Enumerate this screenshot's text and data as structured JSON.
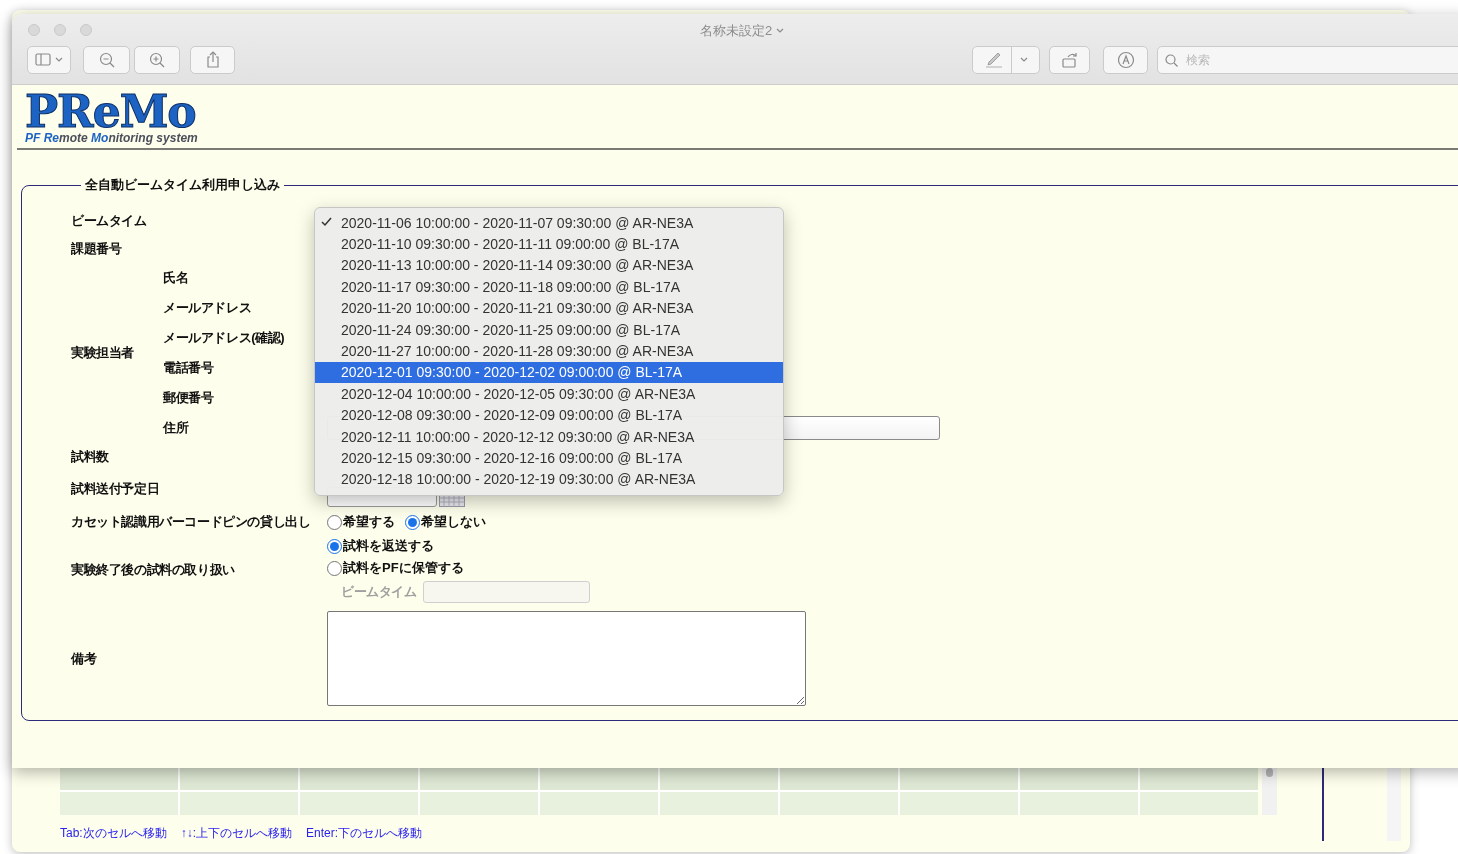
{
  "window": {
    "title": "名称未設定2",
    "search": {
      "placeholder": "検索"
    }
  },
  "logo": {
    "name": "PReMo",
    "tagline": "**PF** **Re**mote **Mo**nitoring system"
  },
  "form": {
    "legend": "全自動ビームタイム利用申し込み",
    "fields": [
      {
        "kind": "label",
        "label": "ビームタイム"
      },
      {
        "kind": "label",
        "label": "課題番号"
      },
      {
        "kind": "group",
        "label": "実験担当者",
        "children": [
          {
            "kind": "label",
            "label": "氏名"
          },
          {
            "kind": "label",
            "label": "メールアドレス"
          },
          {
            "kind": "label",
            "label": "メールアドレス(確認)"
          },
          {
            "kind": "label",
            "label": "電話番号"
          },
          {
            "kind": "label",
            "label": "郵便番号"
          },
          {
            "kind": "text",
            "label": "住所"
          }
        ]
      },
      {
        "kind": "label",
        "label": "試料数"
      },
      {
        "kind": "date",
        "label": "試料送付予定日"
      },
      {
        "kind": "radio",
        "label": "カセット認識用バーコードピンの貸し出し",
        "options": [
          {
            "label": "希望する",
            "selected": false
          },
          {
            "label": "希望しない",
            "selected": true
          }
        ]
      },
      {
        "kind": "radio-stack",
        "label": "実験終了後の試料の取り扱い",
        "options": [
          {
            "label": "試料を返送する",
            "selected": true
          },
          {
            "label": "試料をPFに保管する",
            "selected": false
          }
        ],
        "sub_field": {
          "label": "ビームタイム",
          "disabled": true
        }
      },
      {
        "kind": "textarea",
        "label": "備考"
      }
    ]
  },
  "popup": {
    "options": [
      {
        "text": "2020-11-06 10:00:00 - 2020-11-07 09:30:00 @ AR-NE3A",
        "checked": true,
        "selected": false
      },
      {
        "text": "2020-11-10 09:30:00 - 2020-11-11 09:00:00 @ BL-17A",
        "checked": false,
        "selected": false
      },
      {
        "text": "2020-11-13 10:00:00 - 2020-11-14 09:30:00 @ AR-NE3A",
        "checked": false,
        "selected": false
      },
      {
        "text": "2020-11-17 09:30:00 - 2020-11-18 09:00:00 @ BL-17A",
        "checked": false,
        "selected": false
      },
      {
        "text": "2020-11-20 10:00:00 - 2020-11-21 09:30:00 @ AR-NE3A",
        "checked": false,
        "selected": false
      },
      {
        "text": "2020-11-24 09:30:00 - 2020-11-25 09:00:00 @ BL-17A",
        "checked": false,
        "selected": false
      },
      {
        "text": "2020-11-27 10:00:00 - 2020-11-28 09:30:00 @ AR-NE3A",
        "checked": false,
        "selected": false
      },
      {
        "text": "2020-12-01 09:30:00 - 2020-12-02 09:00:00 @ BL-17A",
        "checked": false,
        "selected": true
      },
      {
        "text": "2020-12-04 10:00:00 - 2020-12-05 09:30:00 @ AR-NE3A",
        "checked": false,
        "selected": false
      },
      {
        "text": "2020-12-08 09:30:00 - 2020-12-09 09:00:00 @ BL-17A",
        "checked": false,
        "selected": false
      },
      {
        "text": "2020-12-11 10:00:00 - 2020-12-12 09:30:00 @ AR-NE3A",
        "checked": false,
        "selected": false
      },
      {
        "text": "2020-12-15 09:30:00 - 2020-12-16 09:00:00 @ BL-17A",
        "checked": false,
        "selected": false
      },
      {
        "text": "2020-12-18 10:00:00 - 2020-12-19 09:30:00 @ AR-NE3A",
        "checked": false,
        "selected": false
      }
    ]
  },
  "background_window": {
    "hints": [
      "Tab:次のセルへ移動",
      "↑↓:上下のセルへ移動",
      "Enter:下のセルへ移動"
    ]
  }
}
